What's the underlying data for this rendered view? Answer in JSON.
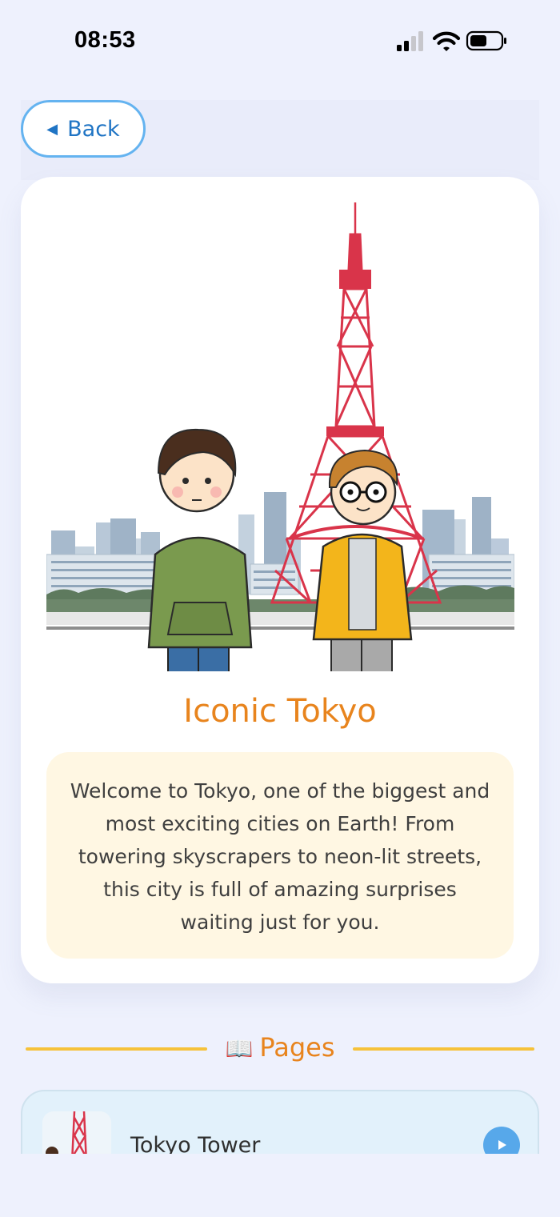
{
  "status_bar": {
    "time": "08:53"
  },
  "nav": {
    "back_label": "Back",
    "back_icon": "triangle-left-icon"
  },
  "story": {
    "title": "Iconic Tokyo",
    "description": "Welcome to Tokyo, one of the biggest and most exciting cities on Earth! From towering skyscrapers to neon-lit streets, this city is full of amazing surprises waiting just for you.",
    "image": "tokyo-tower-two-boys-illustration"
  },
  "pages_section": {
    "icon": "book-icon",
    "title": "Pages",
    "items": [
      {
        "title": "Tokyo Tower",
        "thumbnail": "tokyo-tower-thumbnail",
        "action_icon": "play-icon"
      }
    ]
  },
  "colors": {
    "background": "#EEF1FD",
    "accent_orange": "#E8841D",
    "accent_blue": "#1F74C4",
    "button_border": "#64B3F0",
    "description_bg": "#FFF7E3",
    "divider_yellow": "#F6C23A",
    "list_item_bg": "#E2F1FB"
  }
}
